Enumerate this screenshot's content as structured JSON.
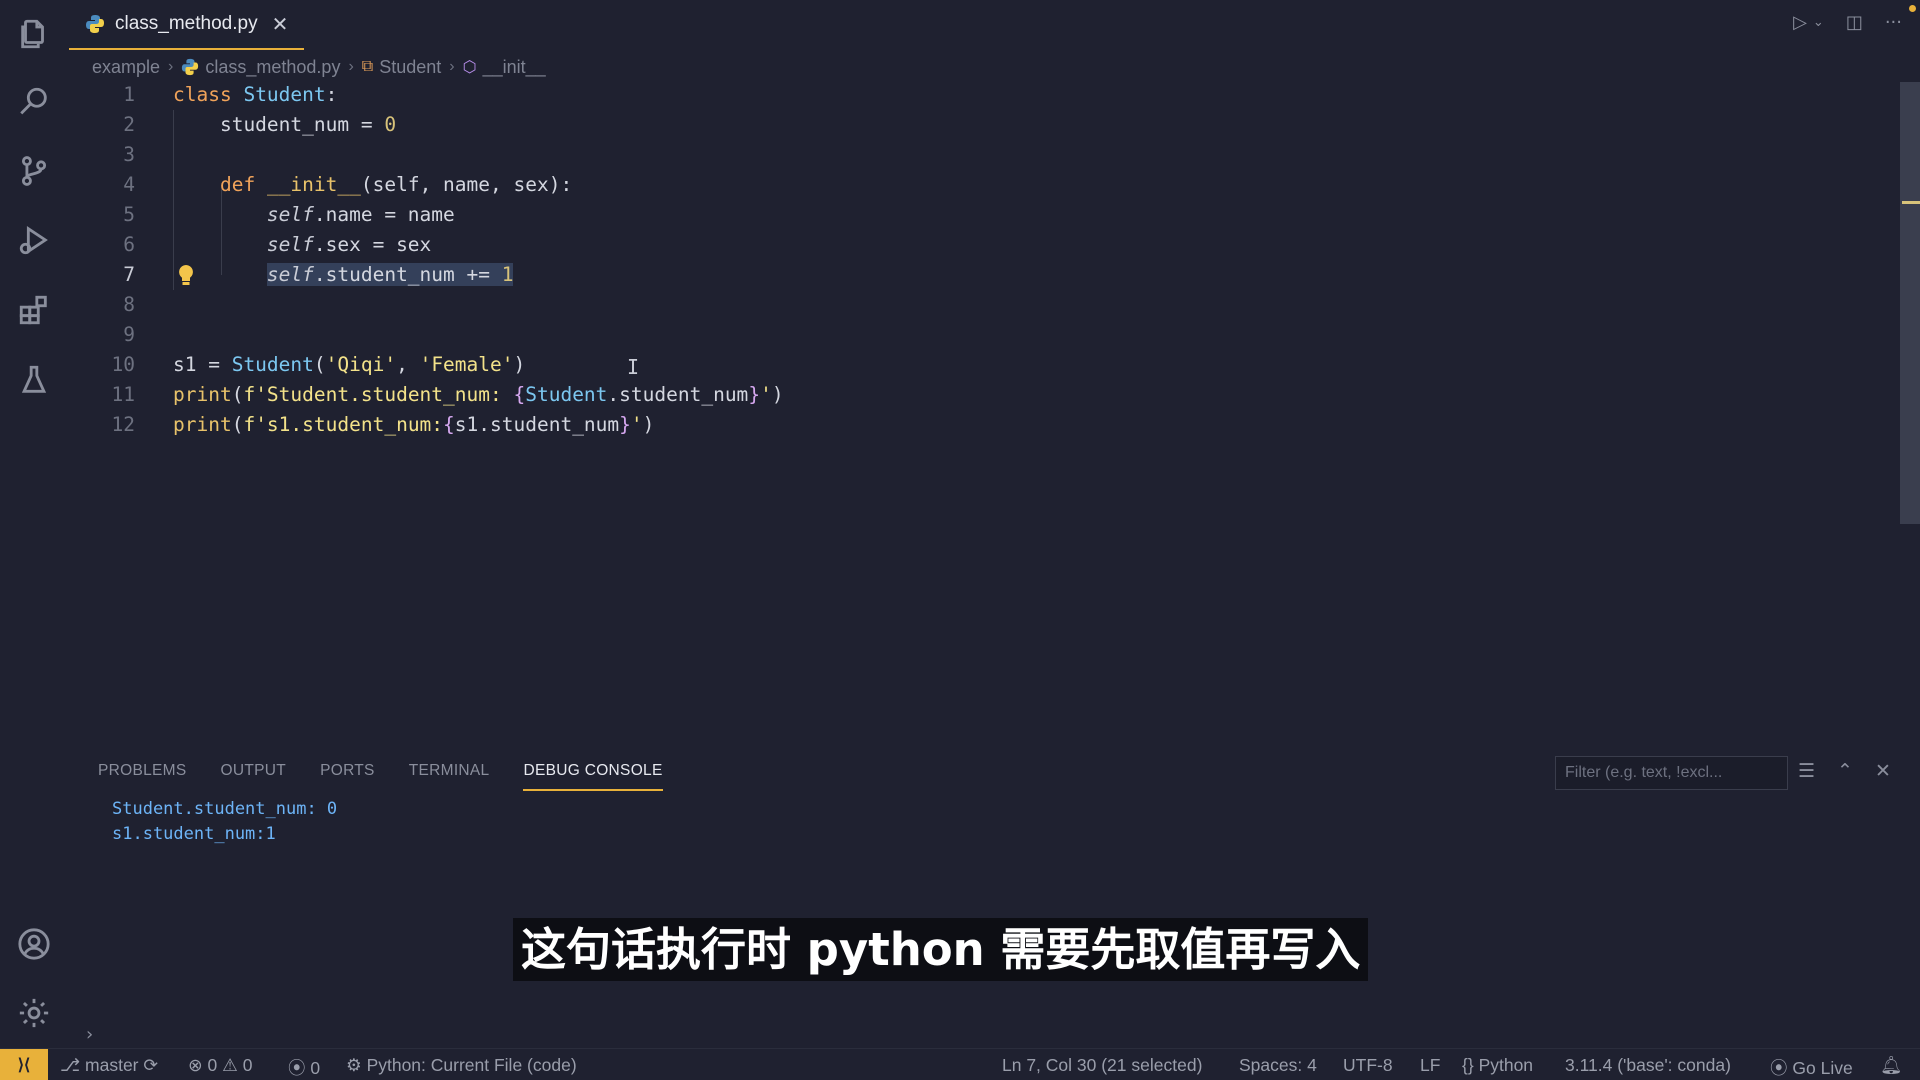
{
  "tab": {
    "filename": "class_method.py"
  },
  "breadcrumb": {
    "folder": "example",
    "file": "class_method.py",
    "class": "Student",
    "method": "__init__"
  },
  "editor": {
    "line_numbers": [
      "1",
      "2",
      "3",
      "4",
      "5",
      "6",
      "7",
      "8",
      "9",
      "10",
      "11",
      "12"
    ],
    "lines": [
      "class Student:",
      "    student_num = 0",
      "",
      "    def __init__(self, name, sex):",
      "        self.name = name",
      "        self.sex = sex",
      "        self.student_num += 1",
      "",
      "",
      "s1 = Student('Qiqi', 'Female')",
      "print(f'Student.student_num: {Student.student_num}')",
      "print(f's1.student_num:{s1.student_num}')"
    ]
  },
  "panel": {
    "tabs": [
      "PROBLEMS",
      "OUTPUT",
      "PORTS",
      "TERMINAL",
      "DEBUG CONSOLE"
    ],
    "active_tab": "DEBUG CONSOLE",
    "filter_placeholder": "Filter (e.g. text, !excl...",
    "console_lines": [
      "Student.student_num: 0",
      "s1.student_num:1"
    ]
  },
  "subtitle": "这句话执行时 python 需要先取值再写入",
  "status": {
    "branch": "master",
    "errors": "0",
    "warnings": "0",
    "ports": "0",
    "run_config": "Python: Current File (code)",
    "cursor": "Ln 7, Col 30 (21 selected)",
    "spaces": "Spaces: 4",
    "encoding": "UTF-8",
    "eol": "LF",
    "language": "Python",
    "interpreter": "3.11.4 ('base': conda)",
    "go_live": "Go Live"
  },
  "colors": {
    "accent": "#e8b13a",
    "background": "#1f2130",
    "console_text": "#6db4f7"
  }
}
